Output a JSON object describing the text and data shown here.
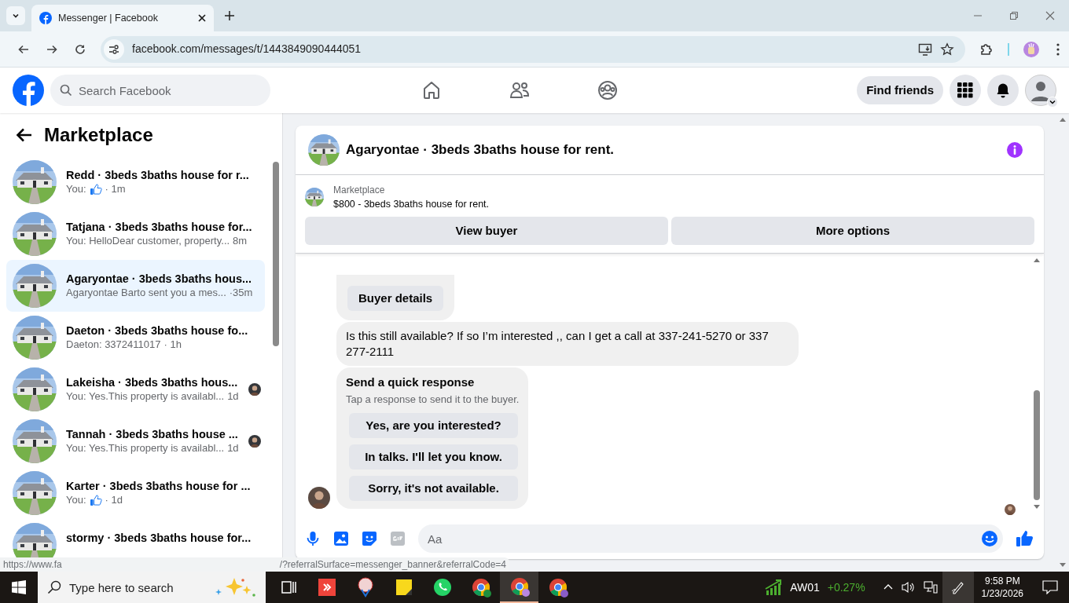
{
  "browser": {
    "tab_title": "Messenger | Facebook",
    "url": "facebook.com/messages/t/1443849090444051"
  },
  "header": {
    "search_placeholder": "Search Facebook",
    "find_friends": "Find friends"
  },
  "sidebar": {
    "title": "Marketplace",
    "conversations": [
      {
        "name": "Redd · 3beds 3baths house for r...",
        "preview": "You:",
        "like": true,
        "time": "· 1m",
        "seen_avatar": false,
        "selected": false
      },
      {
        "name": "Tatjana · 3beds 3baths house for...",
        "preview": "You: HelloDear customer, property...",
        "like": false,
        "time": "8m",
        "seen_avatar": false,
        "selected": false
      },
      {
        "name": "Agaryontae · 3beds 3baths hous...",
        "preview": "Agaryontae Barto sent you a mes...",
        "like": false,
        "time": "·35m",
        "seen_avatar": false,
        "selected": true
      },
      {
        "name": "Daeton · 3beds 3baths house fo...",
        "preview": "Daeton: 3372411017",
        "like": false,
        "time": "· 1h",
        "seen_avatar": false,
        "selected": false
      },
      {
        "name": "Lakeisha · 3beds 3baths hous...",
        "preview": "You: Yes.This property is availabl...",
        "like": false,
        "time": "1d",
        "seen_avatar": true,
        "selected": false
      },
      {
        "name": "Tannah · 3beds 3baths house ...",
        "preview": "You: Yes.This property is availabl...",
        "like": false,
        "time": "1d",
        "seen_avatar": true,
        "selected": false
      },
      {
        "name": "Karter · 3beds 3baths house for ...",
        "preview": "You:",
        "like": true,
        "time": "· 1d",
        "seen_avatar": false,
        "selected": false
      },
      {
        "name": "stormy · 3beds 3baths house for...",
        "like": false,
        "seen_avatar": false,
        "selected": false
      }
    ]
  },
  "chat": {
    "title": "Agaryontae · 3beds 3baths house for rent.",
    "listing": {
      "label": "Marketplace",
      "text": "$800 - 3beds 3baths house for rent."
    },
    "actions": [
      "View buyer",
      "More options"
    ],
    "messages": [
      {
        "kind": "button_card",
        "button": "Buyer details"
      },
      {
        "kind": "text",
        "text": "Is this still available? If so I’m interested ,, can I get a call at 337-241-5270 or 337 277-2111"
      },
      {
        "kind": "quick_response",
        "title": "Send a quick response",
        "subtitle": "Tap a response to send it to the buyer.",
        "options": [
          "Yes, are you interested?",
          "In talks. I'll let you know.",
          "Sorry, it's not available."
        ]
      }
    ],
    "composer_placeholder": "Aa"
  },
  "status_link": {
    "start": "https://www.fa",
    "end": "/?referralSurface=messenger_banner&referralCode=4"
  },
  "taskbar": {
    "search_placeholder": "Type here to search",
    "stock_symbol": "AW01",
    "stock_change": "+0.27%",
    "time": "9:58 PM",
    "date": "1/23/2026"
  }
}
